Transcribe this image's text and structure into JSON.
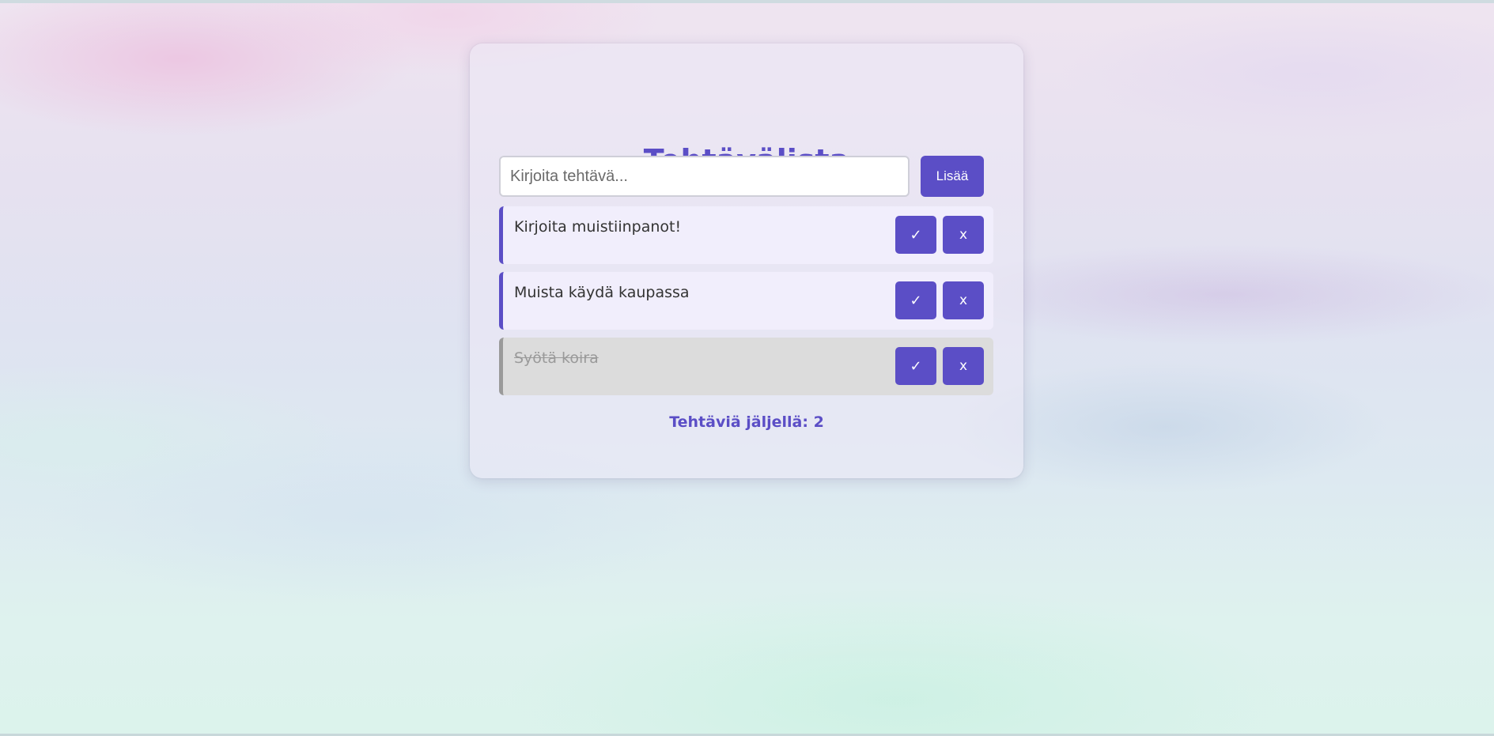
{
  "app": {
    "title": "Tehtävälista"
  },
  "input": {
    "value": "",
    "placeholder": "Kirjoita tehtävä..."
  },
  "add_button_label": "Lisää",
  "tasks": [
    {
      "text": "Kirjoita muistiinpanot!",
      "done": false,
      "done_label": "✓",
      "delete_label": "x"
    },
    {
      "text": "Muista käydä kaupassa",
      "done": false,
      "done_label": "✓",
      "delete_label": "x"
    },
    {
      "text": "Syötä koira",
      "done": true,
      "done_label": "✓",
      "delete_label": "x"
    }
  ],
  "footer": {
    "remaining_text": "Tehtäviä jäljellä: 2"
  },
  "colors": {
    "accent": "#5b4ec6",
    "task_bg": "#f1eefc",
    "task_done_bg": "#dcdcdc",
    "task_done_border": "#9a9a9a"
  }
}
